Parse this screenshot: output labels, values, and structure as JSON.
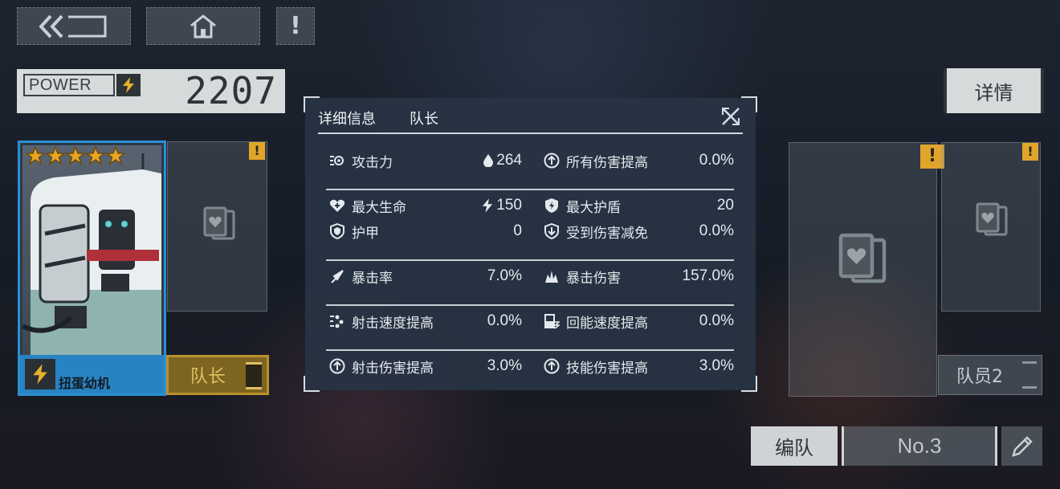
{
  "nav": {
    "back_icon": "double-chevron-back-icon",
    "home_icon": "home-icon",
    "alert_label": "!"
  },
  "power": {
    "label": "POWER",
    "value": "2207"
  },
  "details_button": "详情",
  "leader": {
    "stars": 5,
    "name": "扭蛋幼机",
    "role_label": "队长"
  },
  "member2_label": "队员2",
  "warning_mark": "!",
  "team": {
    "label": "编队",
    "number": "No.3"
  },
  "dialog": {
    "tabs": [
      "详细信息",
      "队长"
    ],
    "stats": {
      "attack": {
        "label": "攻击力",
        "value": "264"
      },
      "all_damage_up": {
        "label": "所有伤害提高",
        "value": "0.0%"
      },
      "max_hp": {
        "label": "最大生命",
        "value": "150"
      },
      "max_shield": {
        "label": "最大护盾",
        "value": "20"
      },
      "armor": {
        "label": "护甲",
        "value": "0"
      },
      "damage_reduction": {
        "label": "受到伤害减免",
        "value": "0.0%"
      },
      "crit_rate": {
        "label": "暴击率",
        "value": "7.0%"
      },
      "crit_damage": {
        "label": "暴击伤害",
        "value": "157.0%"
      },
      "fire_rate_up": {
        "label": "射击速度提高",
        "value": "0.0%"
      },
      "energy_regen_up": {
        "label": "回能速度提高",
        "value": "0.0%"
      },
      "shot_damage_up": {
        "label": "射击伤害提高",
        "value": "3.0%"
      },
      "skill_damage_up": {
        "label": "技能伤害提高",
        "value": "3.0%"
      }
    }
  },
  "colors": {
    "accent_blue": "#2b8fd4",
    "warning_yellow": "#e0a52a",
    "leader_gold": "#b8922a"
  }
}
